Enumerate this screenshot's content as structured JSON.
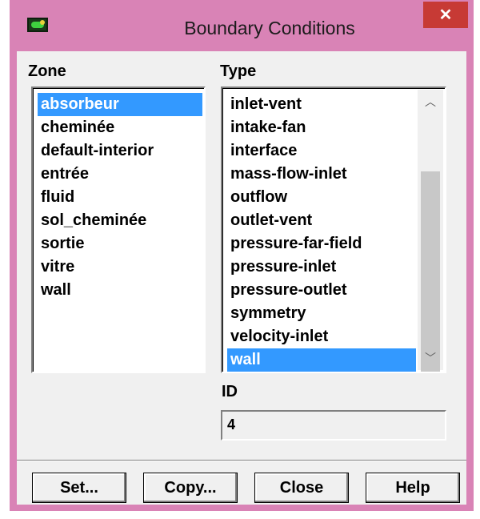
{
  "window": {
    "title": "Boundary Conditions",
    "close_label": "✕",
    "icon": "fluent-app-icon"
  },
  "zone": {
    "label": "Zone",
    "items": [
      "absorbeur",
      "cheminée",
      "default-interior",
      "entrée",
      "fluid",
      "sol_cheminée",
      "sortie",
      "vitre",
      "wall"
    ],
    "selected": "absorbeur"
  },
  "type": {
    "label": "Type",
    "items": [
      "inlet-vent",
      "intake-fan",
      "interface",
      "mass-flow-inlet",
      "outflow",
      "outlet-vent",
      "pressure-far-field",
      "pressure-inlet",
      "pressure-outlet",
      "symmetry",
      "velocity-inlet",
      "wall"
    ],
    "selected": "wall"
  },
  "id": {
    "label": "ID",
    "value": "4"
  },
  "buttons": {
    "set": "Set...",
    "copy": "Copy...",
    "close": "Close",
    "help": "Help"
  },
  "colors": {
    "frame": "#d983b6",
    "selection": "#3399ff",
    "close_button": "#c73a35"
  }
}
